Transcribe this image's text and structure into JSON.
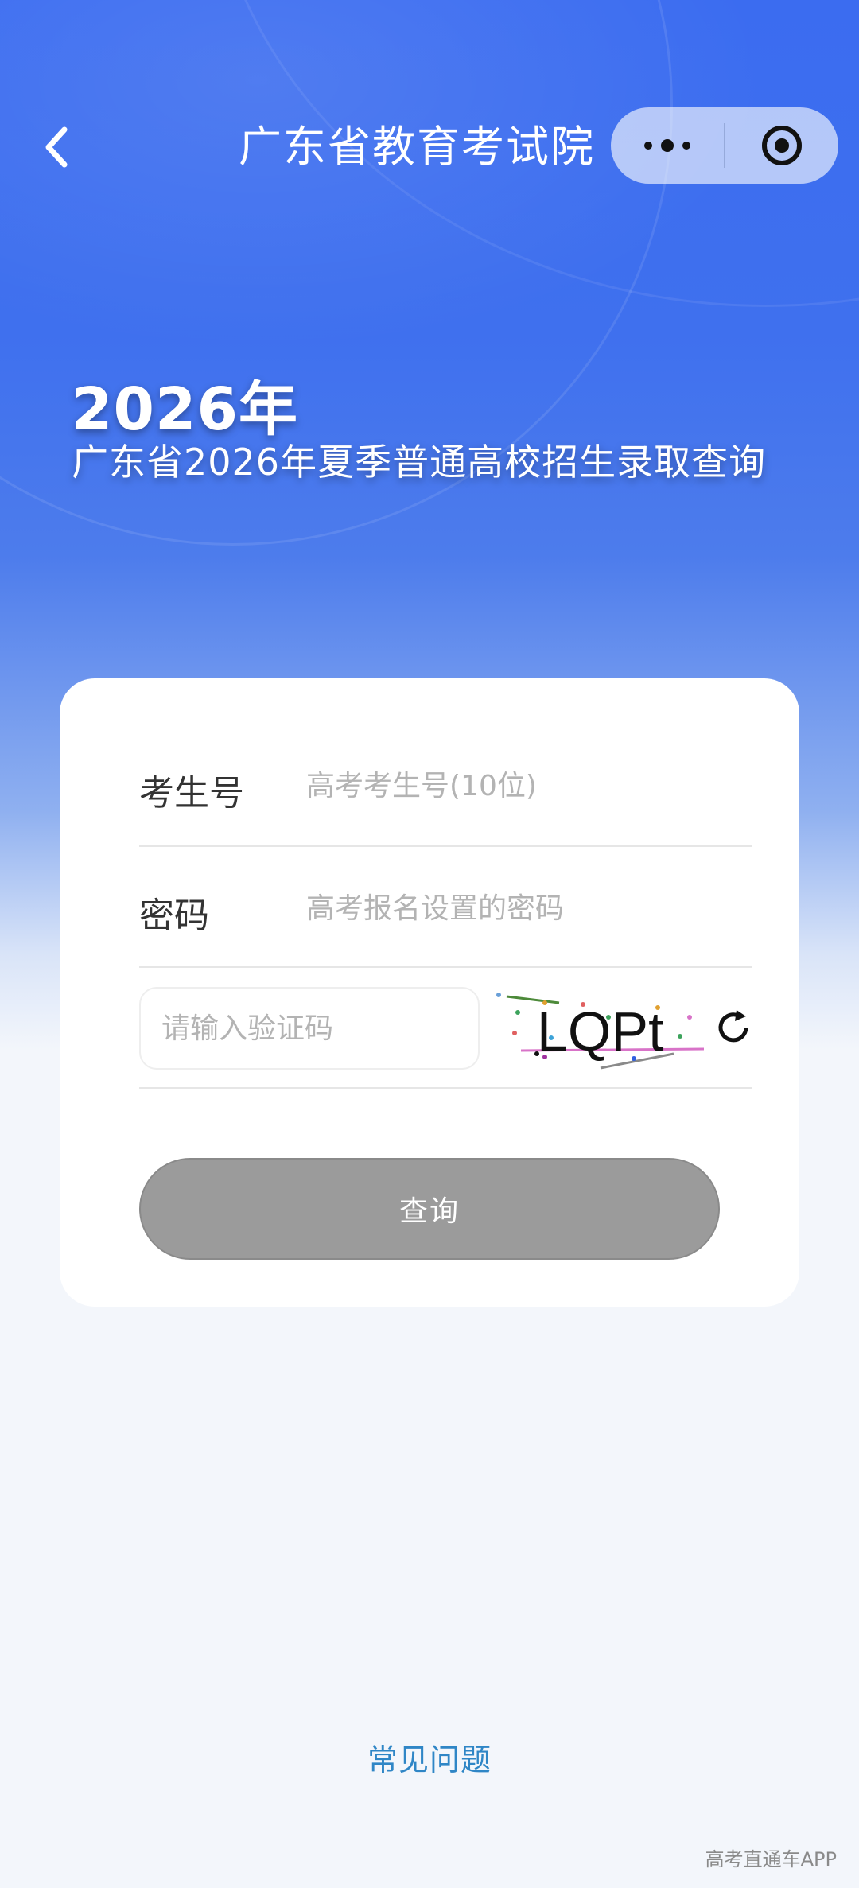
{
  "nav": {
    "title": "广东省教育考试院"
  },
  "headline": {
    "year": "2026年",
    "subtitle": "广东省2026年夏季普通高校招生录取查询"
  },
  "form": {
    "candidate_label": "考生号",
    "candidate_placeholder": "高考考生号(10位)",
    "password_label": "密码",
    "password_placeholder": "高考报名设置的密码",
    "captcha_placeholder": "请输入验证码",
    "captcha_text": "LQPt",
    "submit_label": "查询"
  },
  "footer": {
    "faq_label": "常见问题",
    "watermark": "高考直通车APP"
  },
  "colors": {
    "primary_blue": "#3b6cf0",
    "button_gray": "#9b9b9b",
    "link_blue": "#2f86c6"
  },
  "icons": {
    "back": "chevron-left-icon",
    "more": "more-dots-icon",
    "close": "target-close-icon",
    "refresh": "refresh-icon"
  }
}
